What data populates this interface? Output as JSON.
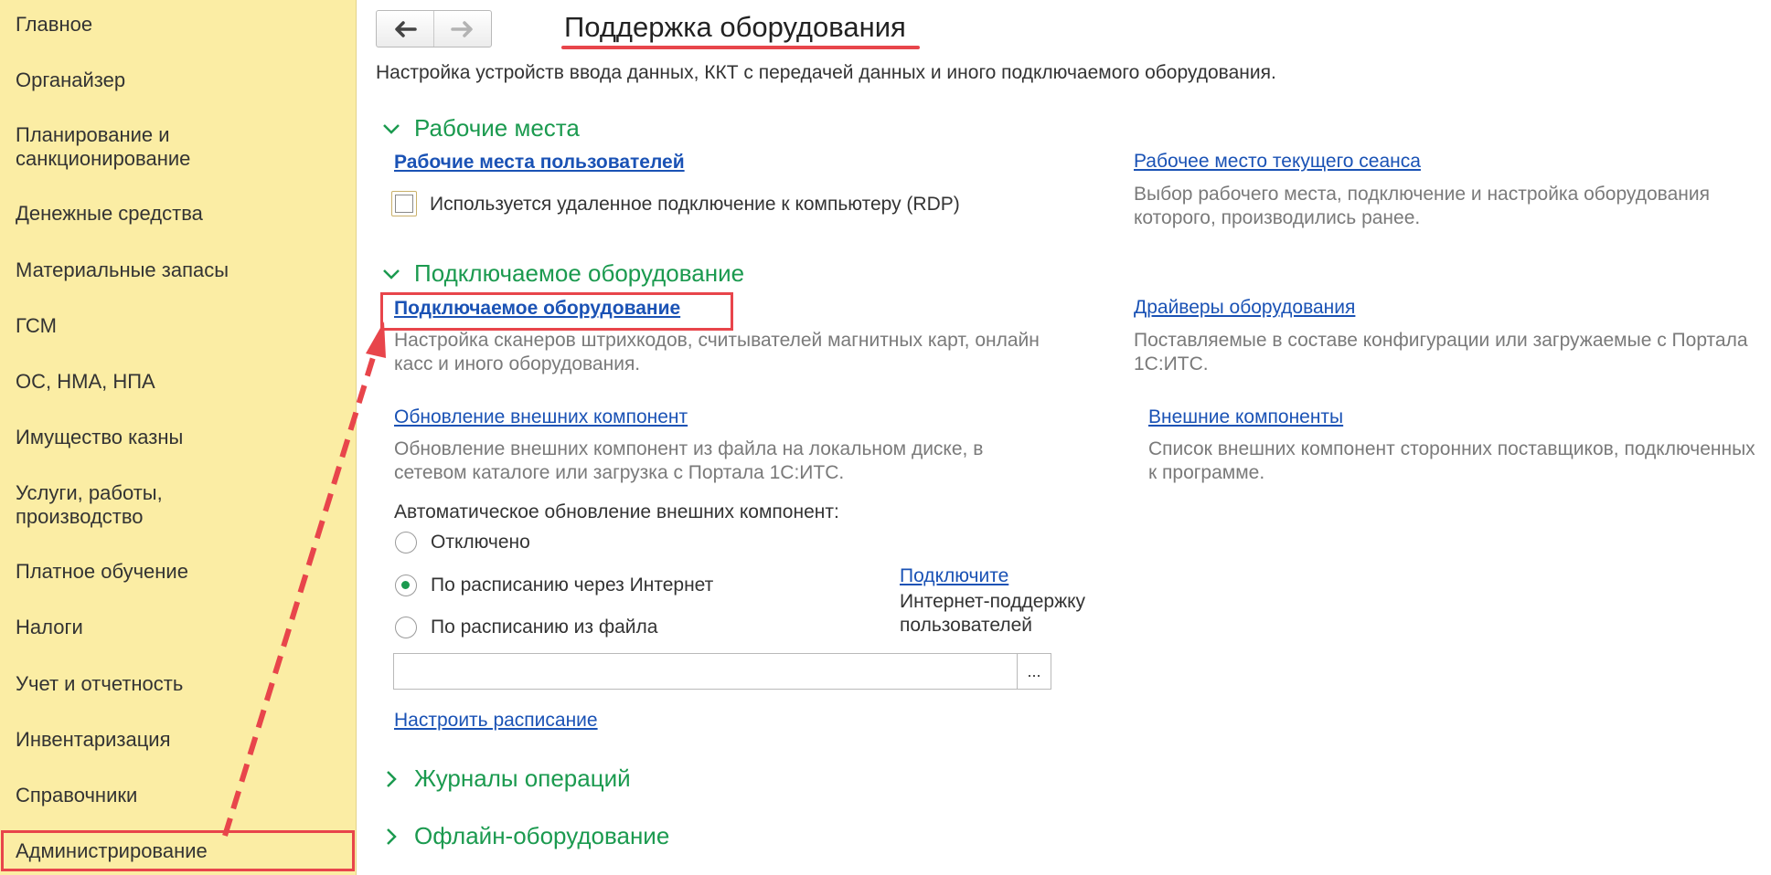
{
  "sidebar": {
    "items": [
      {
        "label": "Главное"
      },
      {
        "label": "Органайзер"
      },
      {
        "label": "Планирование и\nсанкционирование"
      },
      {
        "label": "Денежные средства"
      },
      {
        "label": "Материальные запасы"
      },
      {
        "label": "ГСМ"
      },
      {
        "label": "ОС, НМА, НПА"
      },
      {
        "label": "Имущество казны"
      },
      {
        "label": "Услуги, работы,\nпроизводство"
      },
      {
        "label": "Платное обучение"
      },
      {
        "label": "Налоги"
      },
      {
        "label": "Учет и отчетность"
      },
      {
        "label": "Инвентаризация"
      },
      {
        "label": "Справочники"
      },
      {
        "label": "Администрирование"
      }
    ],
    "active": "Администрирование",
    "bg_color": "#fbeda4"
  },
  "header": {
    "back_icon": "arrow-left-icon",
    "forward_icon": "arrow-right-icon",
    "title": "Поддержка оборудования",
    "description": "Настройка устройств ввода данных, ККТ с передачей данных и иного подключаемого оборудования."
  },
  "workplaces": {
    "heading": "Рабочие места",
    "user_workplaces_link": "Рабочие места пользователей",
    "rdp_checkbox_label": "Используется удаленное подключение к компьютеру (RDP)",
    "rdp_checked": false,
    "current_session_link": "Рабочее место текущего сеанса",
    "current_session_desc": "Выбор рабочего места, подключение и настройка оборудования которого, производились ранее."
  },
  "equipment": {
    "heading": "Подключаемое оборудование",
    "connected_link": "Подключаемое оборудование",
    "connected_desc": "Настройка сканеров штрихкодов, считывателей магнитных карт, онлайн касс и иного оборудования.",
    "drivers_link": "Драйверы оборудования",
    "drivers_desc": "Поставляемые в составе конфигурации или загружаемые с Портала 1С:ИТС.",
    "update_link": "Обновление внешних компонент",
    "update_desc": "Обновление внешних компонент из файла на локальном диске, в сетевом каталоге или загрузка с Портала 1С:ИТС.",
    "external_link": "Внешние компоненты",
    "external_desc": "Список внешних компонент сторонних поставщиков, подключенных к программе.",
    "auto_update_label": "Автоматическое обновление внешних компонент:",
    "radio_options": [
      "Отключено",
      "По расписанию через Интернет",
      "По расписанию из файла"
    ],
    "radio_selected": "По расписанию через Интернет",
    "connect_link": "Подключите",
    "connect_text": "Интернет-поддержку\nпользователей",
    "file_path_value": "",
    "pick_button": "...",
    "schedule_link": "Настроить расписание"
  },
  "collapsed_sections": {
    "journals": "Журналы операций",
    "offline": "Офлайн-оборудование"
  },
  "colors": {
    "accent_green": "#1b9a4f",
    "link_blue": "#1a52b5",
    "annotation_red": "#e8454b"
  }
}
